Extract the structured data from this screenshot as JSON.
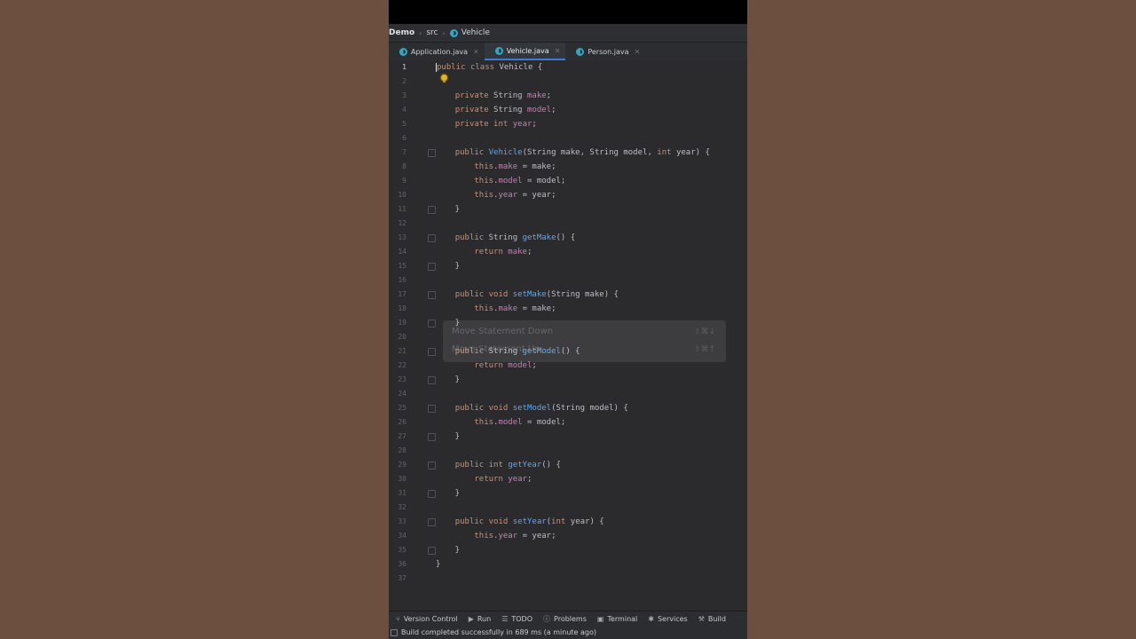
{
  "breadcrumb": [
    "Demo",
    "src",
    "Vehicle"
  ],
  "tabs": [
    {
      "label": "Application.java",
      "active": false
    },
    {
      "label": "Vehicle.java",
      "active": true
    },
    {
      "label": "Person.java",
      "active": false
    }
  ],
  "editor": {
    "current_line": 1,
    "line_numbers": [
      "1",
      "2",
      "3",
      "4",
      "5",
      "6",
      "7",
      "8",
      "9",
      "10",
      "11",
      "12",
      "13",
      "14",
      "15",
      "16",
      "17",
      "18",
      "19",
      "20",
      "21",
      "22",
      "23",
      "24",
      "25",
      "26",
      "27",
      "28",
      "29",
      "30",
      "31",
      "32",
      "33",
      "34",
      "35",
      "36",
      "37"
    ]
  },
  "popup": {
    "item1": "Move Statement Down",
    "item1_shortcut": "⇧⌘↓",
    "item2": "Move Statement Up",
    "item2_shortcut": "⇧⌘↑"
  },
  "toolwindows": [
    {
      "label": "Version Control",
      "icon": "version-control-icon"
    },
    {
      "label": "Run",
      "icon": "run-icon"
    },
    {
      "label": "TODO",
      "icon": "todo-icon"
    },
    {
      "label": "Problems",
      "icon": "problems-icon"
    },
    {
      "label": "Terminal",
      "icon": "terminal-icon"
    },
    {
      "label": "Services",
      "icon": "services-icon"
    },
    {
      "label": "Build",
      "icon": "build-icon"
    }
  ],
  "status": "Build completed successfully in 689 ms (a minute ago)",
  "colors": {
    "keyword": "#cf8e6d",
    "field": "#c77dbb",
    "method": "#56a8f5",
    "accent": "#3a7bd5"
  }
}
